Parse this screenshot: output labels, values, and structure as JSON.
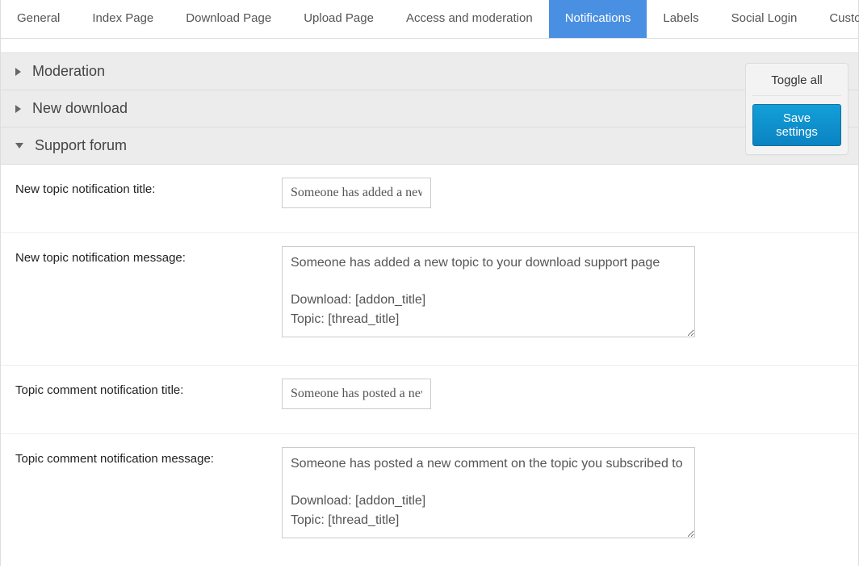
{
  "tabs": [
    {
      "label": "General"
    },
    {
      "label": "Index Page"
    },
    {
      "label": "Download Page"
    },
    {
      "label": "Upload Page"
    },
    {
      "label": "Access and moderation"
    },
    {
      "label": "Notifications",
      "active": true
    },
    {
      "label": "Labels"
    },
    {
      "label": "Social Login"
    },
    {
      "label": "Custom CSS"
    }
  ],
  "panel": {
    "toggle_all": "Toggle all",
    "save": "Save settings"
  },
  "sections": {
    "moderation": {
      "title": "Moderation"
    },
    "new_download": {
      "title": "New download"
    },
    "support_forum": {
      "title": "Support forum"
    }
  },
  "fields": {
    "new_topic_title": {
      "label": "New topic notification title:",
      "value": "Someone has added a new topic"
    },
    "new_topic_message": {
      "label": "New topic notification message:",
      "value": "Someone has added a new topic to your download support page\n\nDownload: [addon_title]\nTopic: [thread_title]"
    },
    "topic_comment_title": {
      "label": "Topic comment notification title:",
      "value": "Someone has posted a new comment"
    },
    "topic_comment_message": {
      "label": "Topic comment notification message:",
      "value": "Someone has posted a new comment on the topic you subscribed to\n\nDownload: [addon_title]\nTopic: [thread_title]"
    }
  }
}
